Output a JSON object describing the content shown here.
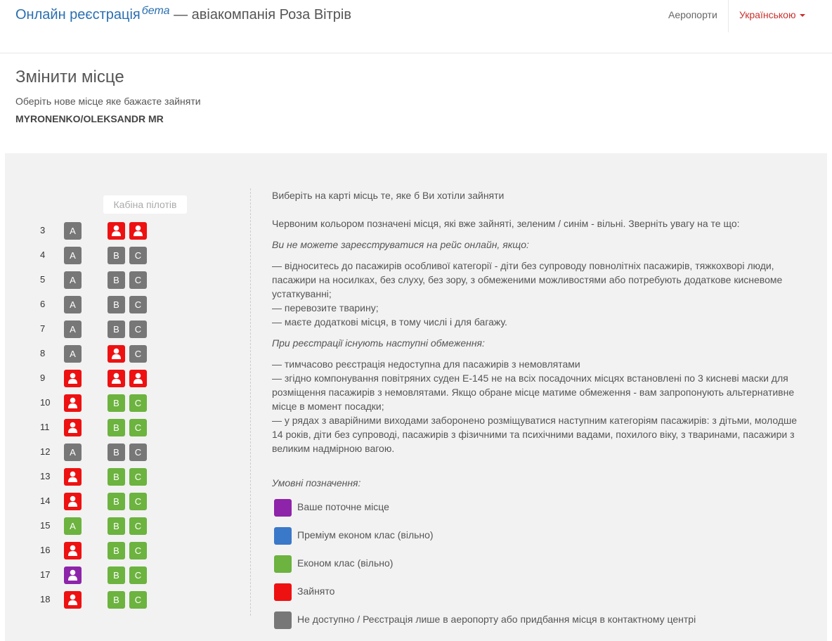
{
  "navbar": {
    "brand": "Онлайн реєстрація",
    "beta": "бета",
    "brand_suffix": " — авіакомпанія Роза Вітрів",
    "airports": "Аеропорти",
    "language": "Українською"
  },
  "page": {
    "title": "Змінити місце",
    "subtitle": "Оберіть нове місце яке бажаєте зайняти",
    "passenger": "MYRONENKO/OLEKSANDR MR"
  },
  "seatmap": {
    "cockpit_label": "Кабіна пілотів",
    "rows": [
      {
        "number": "3",
        "seats": [
          {
            "letter": "A",
            "status": "unavailable"
          },
          {
            "letter": "B",
            "status": "occupied"
          },
          {
            "letter": "C",
            "status": "occupied"
          }
        ]
      },
      {
        "number": "4",
        "seats": [
          {
            "letter": "A",
            "status": "unavailable"
          },
          {
            "letter": "B",
            "status": "unavailable"
          },
          {
            "letter": "C",
            "status": "unavailable"
          }
        ]
      },
      {
        "number": "5",
        "seats": [
          {
            "letter": "A",
            "status": "unavailable"
          },
          {
            "letter": "B",
            "status": "unavailable"
          },
          {
            "letter": "C",
            "status": "unavailable"
          }
        ]
      },
      {
        "number": "6",
        "seats": [
          {
            "letter": "A",
            "status": "unavailable"
          },
          {
            "letter": "B",
            "status": "unavailable"
          },
          {
            "letter": "C",
            "status": "unavailable"
          }
        ]
      },
      {
        "number": "7",
        "seats": [
          {
            "letter": "A",
            "status": "unavailable"
          },
          {
            "letter": "B",
            "status": "unavailable"
          },
          {
            "letter": "C",
            "status": "unavailable"
          }
        ]
      },
      {
        "number": "8",
        "seats": [
          {
            "letter": "A",
            "status": "unavailable"
          },
          {
            "letter": "B",
            "status": "occupied"
          },
          {
            "letter": "C",
            "status": "unavailable"
          }
        ]
      },
      {
        "number": "9",
        "seats": [
          {
            "letter": "A",
            "status": "occupied"
          },
          {
            "letter": "B",
            "status": "occupied"
          },
          {
            "letter": "C",
            "status": "occupied"
          }
        ]
      },
      {
        "number": "10",
        "seats": [
          {
            "letter": "A",
            "status": "occupied"
          },
          {
            "letter": "B",
            "status": "free"
          },
          {
            "letter": "C",
            "status": "free"
          }
        ]
      },
      {
        "number": "11",
        "seats": [
          {
            "letter": "A",
            "status": "occupied"
          },
          {
            "letter": "B",
            "status": "free"
          },
          {
            "letter": "C",
            "status": "free"
          }
        ]
      },
      {
        "number": "12",
        "seats": [
          {
            "letter": "A",
            "status": "unavailable"
          },
          {
            "letter": "B",
            "status": "unavailable"
          },
          {
            "letter": "C",
            "status": "unavailable"
          }
        ]
      },
      {
        "number": "13",
        "seats": [
          {
            "letter": "A",
            "status": "occupied"
          },
          {
            "letter": "B",
            "status": "free"
          },
          {
            "letter": "C",
            "status": "free"
          }
        ]
      },
      {
        "number": "14",
        "seats": [
          {
            "letter": "A",
            "status": "occupied"
          },
          {
            "letter": "B",
            "status": "free"
          },
          {
            "letter": "C",
            "status": "free"
          }
        ]
      },
      {
        "number": "15",
        "seats": [
          {
            "letter": "A",
            "status": "free"
          },
          {
            "letter": "B",
            "status": "free"
          },
          {
            "letter": "C",
            "status": "free"
          }
        ]
      },
      {
        "number": "16",
        "seats": [
          {
            "letter": "A",
            "status": "occupied"
          },
          {
            "letter": "B",
            "status": "free"
          },
          {
            "letter": "C",
            "status": "free"
          }
        ]
      },
      {
        "number": "17",
        "seats": [
          {
            "letter": "A",
            "status": "current"
          },
          {
            "letter": "B",
            "status": "free"
          },
          {
            "letter": "C",
            "status": "free"
          }
        ]
      },
      {
        "number": "18",
        "seats": [
          {
            "letter": "A",
            "status": "occupied"
          },
          {
            "letter": "B",
            "status": "free"
          },
          {
            "letter": "C",
            "status": "free"
          }
        ]
      }
    ]
  },
  "info": {
    "intro": "Виберіть на карті місць те, яке б Ви хотіли зайняти",
    "colors_note": "Червоним кольором позначені місця, які вже зайняті, зеленим / синім - вільні. Зверніть увагу на те що:",
    "cannot_title": "Ви не можете зареєструватися на рейс онлайн, якщо:",
    "cannot_1": "— відноситесь до пасажирів особливої категорії - діти без супроводу повнолітніх пасажирів, тяжкохворі люди, пасажири на носилках, без слуху, без зору, з обмеженими можливостями або потребують додаткове кисневоме устаткуванні;",
    "cannot_2": "— перевозите тварину;",
    "cannot_3": "— маєте додаткові місця, в тому числі і для багажу.",
    "restrictions_title": "При реєстрації існують наступні обмеження:",
    "restr_1": "— тимчасово реєстрація недоступна для пасажирів з немовлятами",
    "restr_2": "— згідно компонування повітряних суден Е-145 не на всіх посадочних місцях встановлені по 3 кисневі маски для розміщення пасажирів з немовлятами. Якщо обране місце матиме обмеження - вам запропонують альтернативне місце в момент посадки;",
    "restr_3": "— у рядах з аварійними виходами заборонено розміщуватися наступним категоріям пасажирів: з дітьми, молодше 14 років, діти без супроводі, пасажирів з фізичними та психічними вадами, похилого віку, з тваринами, пасажири з великим надмірною вагою."
  },
  "legend": {
    "title": "Умовні позначення:",
    "items": [
      {
        "label": "Ваше поточне місце",
        "color": "#8e24aa"
      },
      {
        "label": "Преміум економ клас (вільно)",
        "color": "#3a78c9"
      },
      {
        "label": "Економ клас (вільно)",
        "color": "#6cb33f"
      },
      {
        "label": "Зайнято",
        "color": "#ee1111"
      },
      {
        "label": "Не доступно / Реєстрація лише в аеропорту або придбання місця в контактному центрі",
        "color": "#777777"
      }
    ]
  },
  "colors": {
    "brand": "#2a6fb0",
    "language": "#c9302c",
    "free": "#6cb33f",
    "occupied": "#ee1111",
    "unavailable": "#777777",
    "current": "#8e24aa",
    "panel_bg": "#f2f2f2"
  },
  "icons": {
    "occupied_seat": "person-icon",
    "language_dropdown": "caret-down-icon"
  }
}
